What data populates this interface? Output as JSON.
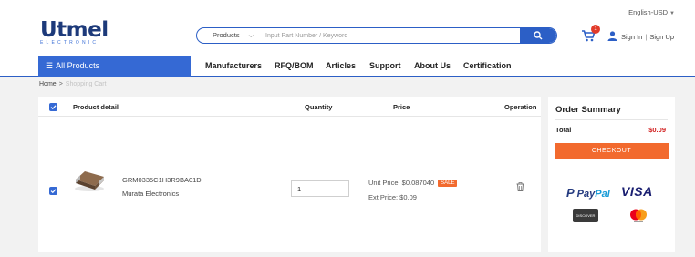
{
  "header": {
    "language": "English-USD",
    "logo": {
      "main": "Utmel",
      "sub": "ELECTRONIC"
    },
    "search": {
      "category": "Products",
      "placeholder": "Input Part Number / Keyword"
    },
    "cart_count": "1",
    "sign_in": "Sign In",
    "sign_up": "Sign Up"
  },
  "nav": {
    "all_products": "All Products",
    "items": [
      "Manufacturers",
      "RFQ/BOM",
      "Articles",
      "Support",
      "About Us",
      "Certification"
    ]
  },
  "breadcrumb": {
    "home": "Home",
    "current": "Shopping Cart"
  },
  "cart": {
    "columns": {
      "product": "Product detail",
      "quantity": "Quantity",
      "price": "Price",
      "operation": "Operation"
    },
    "items": [
      {
        "part_number": "GRM0335C1H3R9BA01D",
        "manufacturer": "Murata Electronics",
        "quantity": "1",
        "unit_price": "Unit Price: $0.087040",
        "badge": "SALE",
        "ext_price": "Ext Price: $0.09"
      }
    ]
  },
  "summary": {
    "title": "Order Summary",
    "total_label": "Total",
    "total_value": "$0.09",
    "checkout": "CHECKOUT",
    "payment_methods": {
      "paypal_pay": "Pay",
      "paypal_pal": "Pal",
      "visa": "VISA",
      "discover": "DISCOVER"
    }
  },
  "colors": {
    "primary": "#3569d4",
    "accent": "#f26a2e",
    "price_red": "#d21e1e"
  }
}
